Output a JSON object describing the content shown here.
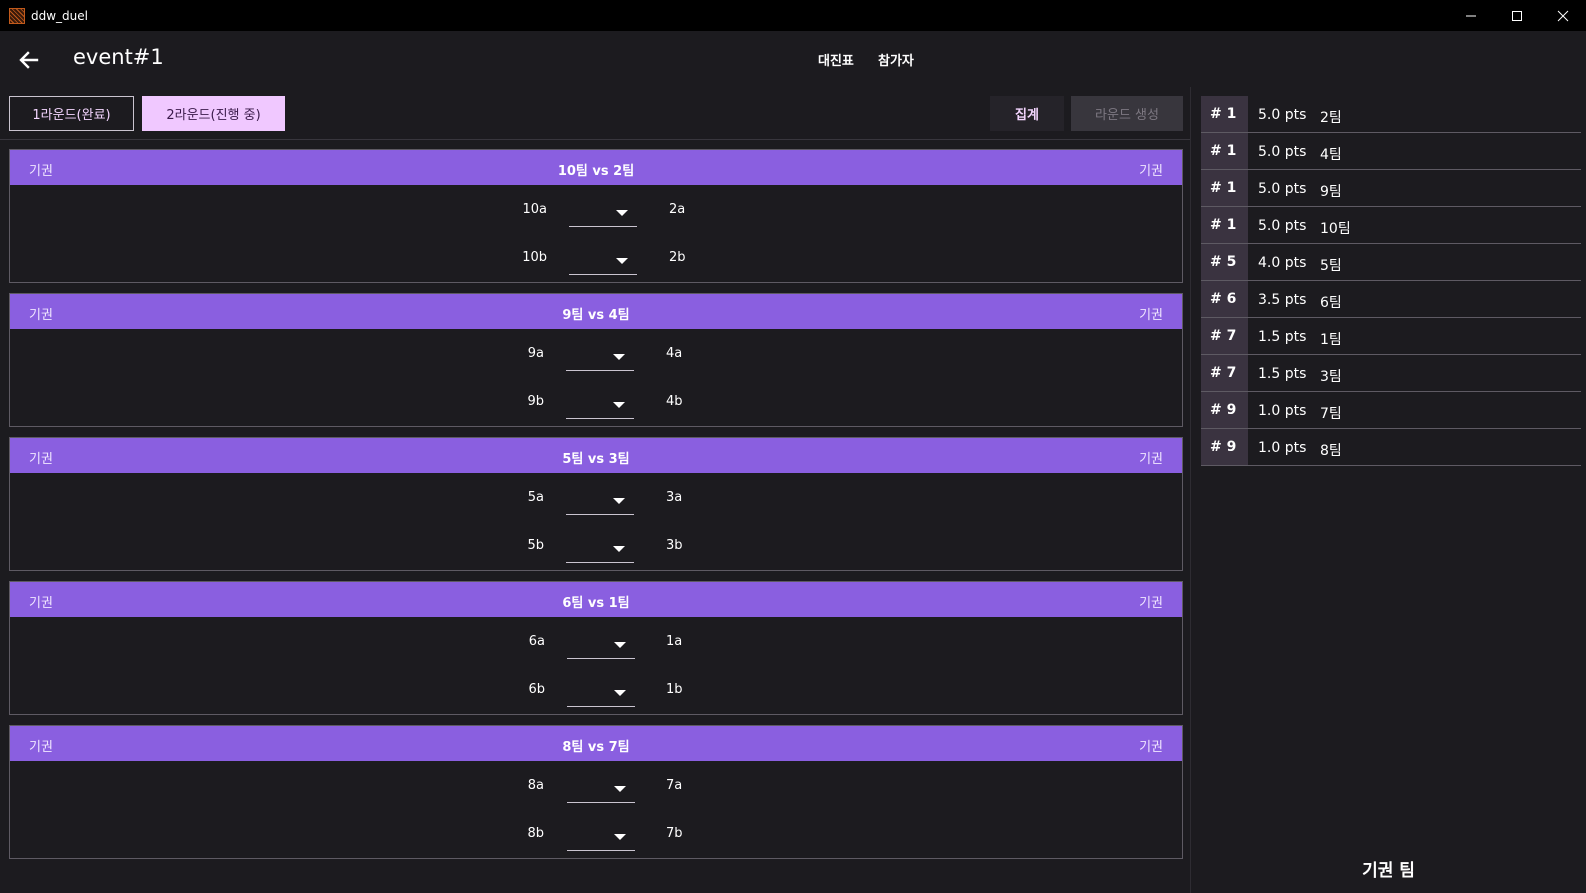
{
  "window": {
    "title": "ddw_duel"
  },
  "appbar": {
    "title": "event#1",
    "tabs": [
      "대진표",
      "참가자"
    ]
  },
  "rounds": [
    {
      "label": "1라운드(완료)",
      "selected": false
    },
    {
      "label": "2라운드(진행 중)",
      "selected": true
    }
  ],
  "actions": {
    "tally": "집계",
    "create_round": "라운드 생성"
  },
  "forfeit_label": "기권",
  "matches": [
    {
      "title": "10팀 vs 2팀",
      "pairs": [
        {
          "left": "10a",
          "right": "2a"
        },
        {
          "left": "10b",
          "right": "2b"
        }
      ]
    },
    {
      "title": "9팀 vs 4팀",
      "pairs": [
        {
          "left": "9a",
          "right": "4a"
        },
        {
          "left": "9b",
          "right": "4b"
        }
      ]
    },
    {
      "title": "5팀 vs 3팀",
      "pairs": [
        {
          "left": "5a",
          "right": "3a"
        },
        {
          "left": "5b",
          "right": "3b"
        }
      ]
    },
    {
      "title": "6팀 vs 1팀",
      "pairs": [
        {
          "left": "6a",
          "right": "1a"
        },
        {
          "left": "6b",
          "right": "1b"
        }
      ]
    },
    {
      "title": "8팀 vs 7팀",
      "pairs": [
        {
          "left": "8a",
          "right": "7a"
        },
        {
          "left": "8b",
          "right": "7b"
        }
      ]
    }
  ],
  "ranking": [
    {
      "rank": "# 1",
      "pts": "5.0 pts",
      "team": "2팀"
    },
    {
      "rank": "# 1",
      "pts": "5.0 pts",
      "team": "4팀"
    },
    {
      "rank": "# 1",
      "pts": "5.0 pts",
      "team": "9팀"
    },
    {
      "rank": "# 1",
      "pts": "5.0 pts",
      "team": "10팀"
    },
    {
      "rank": "# 5",
      "pts": "4.0 pts",
      "team": "5팀"
    },
    {
      "rank": "# 6",
      "pts": "3.5 pts",
      "team": "6팀"
    },
    {
      "rank": "# 7",
      "pts": "1.5 pts",
      "team": "1팀"
    },
    {
      "rank": "# 7",
      "pts": "1.5 pts",
      "team": "3팀"
    },
    {
      "rank": "# 9",
      "pts": "1.0 pts",
      "team": "7팀"
    },
    {
      "rank": "# 9",
      "pts": "1.0 pts",
      "team": "8팀"
    }
  ],
  "forfeit_teams_title": "기권 팀",
  "colors": {
    "accent": "#8a5fe0",
    "selected_round": "#f0c8ff",
    "background": "#1c1b1f"
  },
  "icons": {
    "back": "arrow-left-icon",
    "minimize": "minimize-icon",
    "maximize": "maximize-icon",
    "close": "close-icon",
    "dropdown": "chevron-down-icon"
  }
}
